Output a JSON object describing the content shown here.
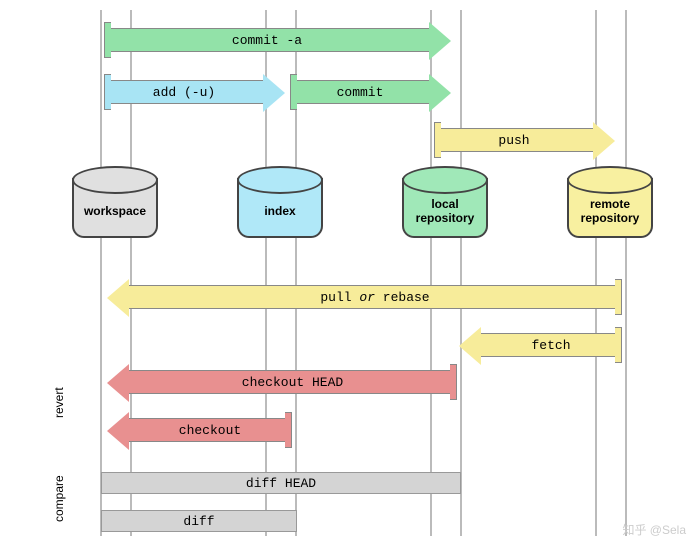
{
  "locations": {
    "workspace": "workspace",
    "index": "index",
    "local": "local repository",
    "remote": "remote repository"
  },
  "arrows": {
    "commit_a": "commit -a",
    "add": "add (-u)",
    "commit": "commit",
    "push": "push",
    "pull": "pull ",
    "or": "or",
    "rebase": " rebase",
    "fetch": "fetch",
    "checkout_head": "checkout HEAD",
    "checkout": "checkout",
    "diff_head": "diff HEAD",
    "diff": "diff"
  },
  "side": {
    "revert": "revert",
    "compare": "compare"
  },
  "watermark": "知乎 @Sela"
}
